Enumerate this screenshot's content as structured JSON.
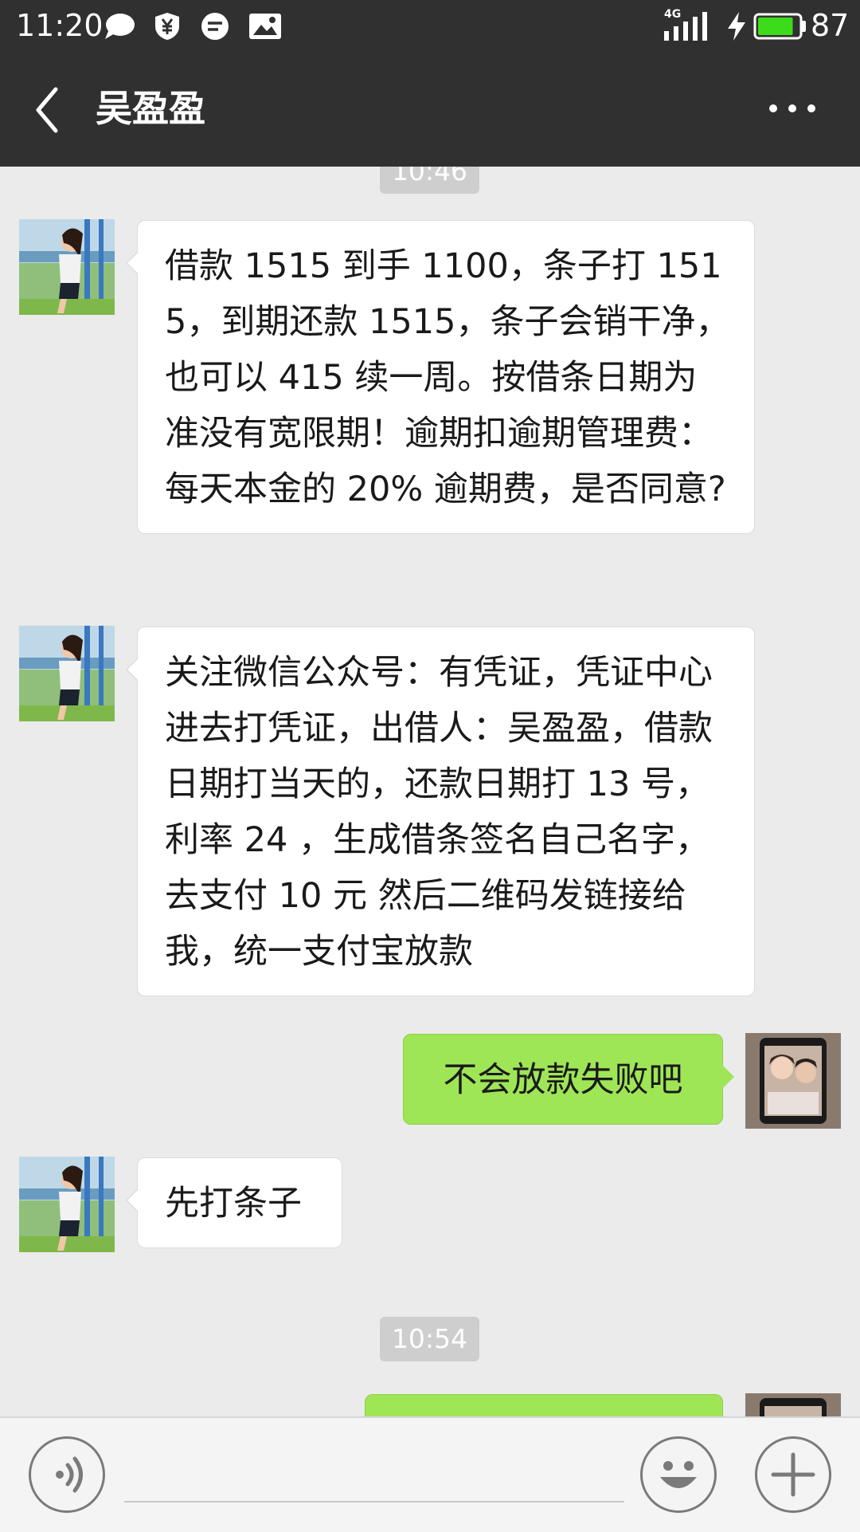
{
  "status_bar": {
    "time": "11:20",
    "network": "4G",
    "battery_percent": "87",
    "icons": [
      "chat-bubble-icon",
      "shield-yen-icon",
      "message-icon",
      "image-icon",
      "signal-icon",
      "charging-icon",
      "battery-icon"
    ]
  },
  "header": {
    "title": "吴盈盈",
    "back_icon": "back-arrow-icon",
    "more_icon": "more-dots-icon"
  },
  "chat": {
    "timestamps": [
      "10:46",
      "10:54"
    ],
    "messages": [
      {
        "side": "left",
        "text": "借款 1515 到手 1100，条子打 1515，到期还款 1515，条子会销干净，也可以 415 续一周。按借条日期为准没有宽限期！逾期扣逾期管理费：每天本金的 20% 逾期费，是否同意?"
      },
      {
        "side": "left",
        "text": "关注微信公众号：有凭证，凭证中心进去打凭证，出借人：吴盈盈，借款日期打当天的，还款日期打 13 号，利率 24 ，生成借条签名自己名字，去支付 10 元  然后二维码发链接给我，统一支付宝放款"
      },
      {
        "side": "right",
        "text": "不会放款失败吧"
      },
      {
        "side": "left",
        "text": "先打条子"
      },
      {
        "side": "right",
        "text": ""
      }
    ]
  },
  "input_bar": {
    "voice_icon": "voice-icon",
    "emoji_icon": "emoji-icon",
    "plus_icon": "plus-icon",
    "input_value": ""
  },
  "colors": {
    "header_bg": "#303030",
    "chat_bg": "#ebebeb",
    "sent_bubble": "#9fe657",
    "received_bubble": "#ffffff",
    "battery_green": "#3ddc1a"
  }
}
